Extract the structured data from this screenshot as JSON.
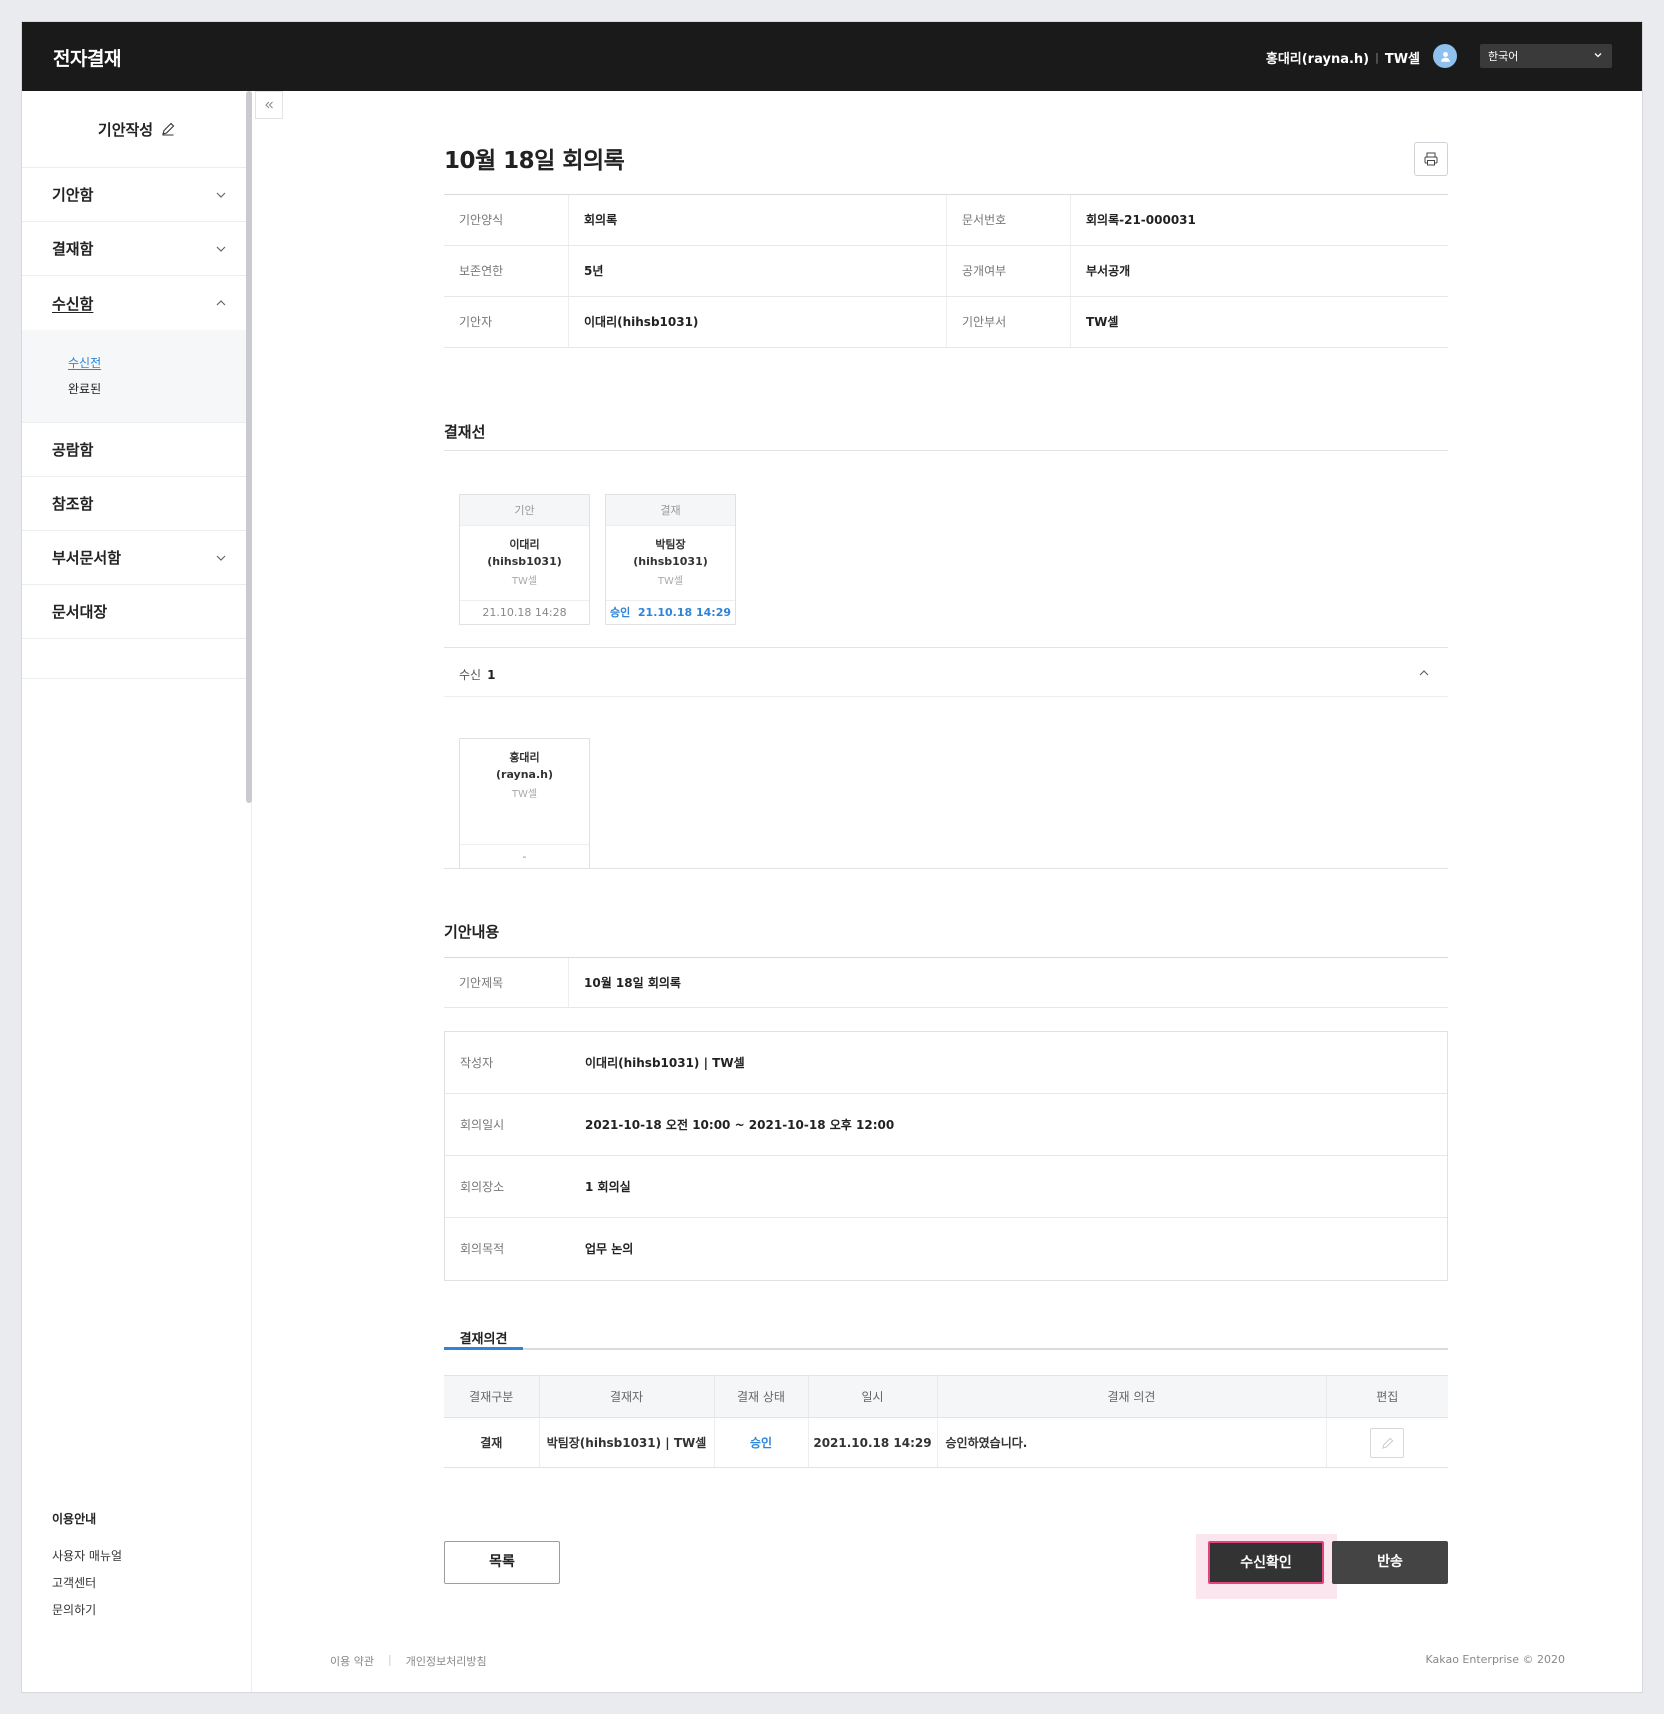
{
  "header": {
    "brand": "전자결재",
    "user_name": "홍대리(rayna.h)",
    "user_dept": "TW셀",
    "language": "한국어"
  },
  "sidebar": {
    "compose": "기안작성",
    "items": [
      {
        "label": "기안함"
      },
      {
        "label": "결재함"
      },
      {
        "label": "수신함"
      },
      {
        "label": "공람함"
      },
      {
        "label": "참조함"
      },
      {
        "label": "부서문서함"
      },
      {
        "label": "문서대장"
      }
    ],
    "inbox_sub": [
      "수신전",
      "완료된"
    ],
    "guide_title": "이용안내",
    "guide_links": [
      "사용자 매뉴얼",
      "고객센터",
      "문의하기"
    ]
  },
  "doc": {
    "title": "10월 18일 회의록",
    "info": [
      {
        "label": "기안양식",
        "value": "회의록",
        "label2": "문서번호",
        "value2": "회의록-21-000031"
      },
      {
        "label": "보존연한",
        "value": "5년",
        "label2": "공개여부",
        "value2": "부서공개"
      },
      {
        "label": "기안자",
        "value": "이대리(hihsb1031)",
        "label2": "기안부서",
        "value2": "TW셀"
      }
    ]
  },
  "approval_line": {
    "title": "결재선",
    "approvers": [
      {
        "type": "기안",
        "name": "이대리",
        "id": "(hihsb1031)",
        "dept": "TW셀",
        "status": "",
        "date": "21.10.18 14:28"
      },
      {
        "type": "결재",
        "name": "박팀장",
        "id": "(hihsb1031)",
        "dept": "TW셀",
        "status": "승인",
        "date": "21.10.18 14:29"
      }
    ]
  },
  "receivers": {
    "label": "수신",
    "count": "1",
    "items": [
      {
        "name": "홍대리",
        "id": "(rayna.h)",
        "dept": "TW셀",
        "date": "-"
      }
    ]
  },
  "content": {
    "title": "기안내용",
    "subject_label": "기안제목",
    "subject_value": "10월 18일 회의록",
    "minutes": [
      {
        "label": "작성자",
        "value": "이대리(hihsb1031) | TW셀"
      },
      {
        "label": "회의일시",
        "value": "2021-10-18 오전 10:00 ~ 2021-10-18 오후 12:00"
      },
      {
        "label": "회의장소",
        "value": "1 회의실"
      },
      {
        "label": "회의목적",
        "value": "업무 논의"
      }
    ]
  },
  "opinions": {
    "tab": "결재의견",
    "columns": [
      "결재구분",
      "결재자",
      "결재 상태",
      "일시",
      "결재 의견",
      "편집"
    ],
    "rows": [
      {
        "type": "결재",
        "approver": "박팀장(hihsb1031) | TW셀",
        "status": "승인",
        "date": "2021.10.18 14:29",
        "comment": "승인하였습니다."
      }
    ]
  },
  "buttons": {
    "list": "목록",
    "confirm": "수신확인",
    "return": "반송"
  },
  "footer": {
    "terms": "이용 약관",
    "privacy": "개인정보처리방침",
    "copyright": "Kakao Enterprise © 2020"
  },
  "colors": {
    "topbar": "#1a1a1a",
    "accent_blue": "#2e84d8",
    "highlight_pink": "#e0457b"
  }
}
